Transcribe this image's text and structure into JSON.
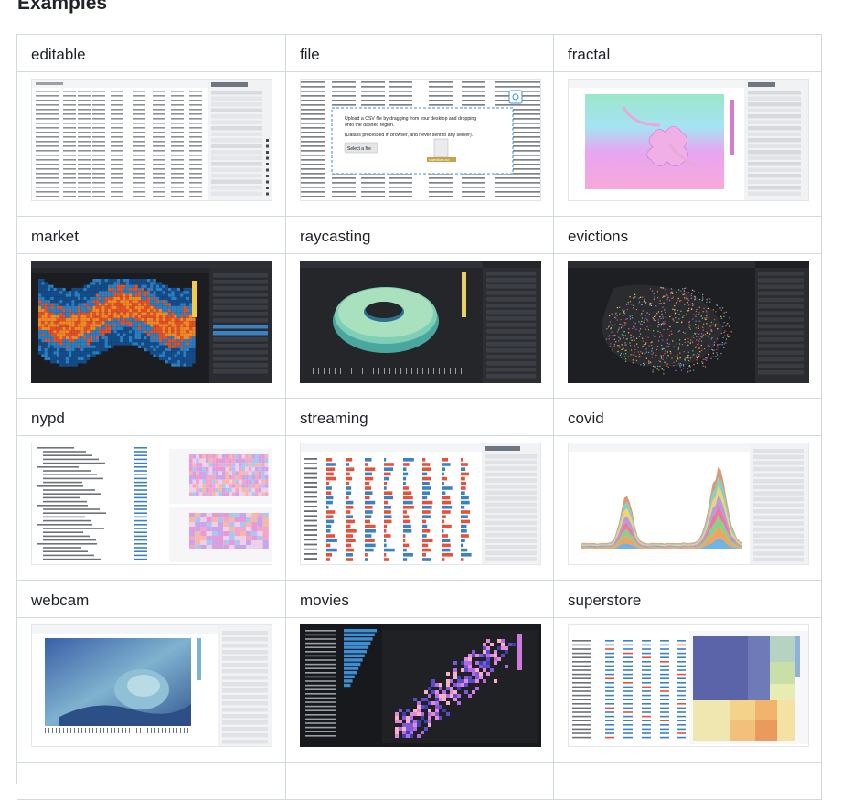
{
  "page": {
    "heading": "Examples"
  },
  "examples": [
    {
      "name": "editable"
    },
    {
      "name": "file"
    },
    {
      "name": "fractal"
    },
    {
      "name": "market"
    },
    {
      "name": "raycasting"
    },
    {
      "name": "evictions"
    },
    {
      "name": "nypd"
    },
    {
      "name": "streaming"
    },
    {
      "name": "covid"
    },
    {
      "name": "webcam"
    },
    {
      "name": "movies"
    },
    {
      "name": "superstore"
    }
  ],
  "file_thumb": {
    "instruction": "Upload a CSV file by dragging from your desktop and dropping onto the dashed region.",
    "privacy": "(Data is processed in browser, and never sent to any server).",
    "button": "Select a file",
    "file_label": "superstore.csv"
  },
  "panel_labels": {
    "datagrid": "Datagrid",
    "heatmap": "Heatmap",
    "map_scatter": "Map Scatter",
    "area": "Y Area",
    "treemap": "Treemap"
  },
  "colors": {
    "grid_border": "#d1d9e0",
    "dark_panel": "#25262a",
    "accent_blue": "#1f77b4",
    "accent_red": "#e8503a"
  }
}
